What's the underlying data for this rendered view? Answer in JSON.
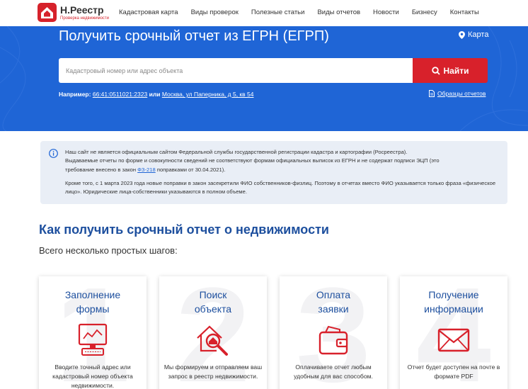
{
  "header": {
    "logo_name": "Н.Реестр",
    "logo_sub": "Проверка недвижимости",
    "nav": [
      "Кадастровая карта",
      "Виды проверок",
      "Полезные статьи",
      "Виды отчетов",
      "Новости",
      "Бизнесу",
      "Контакты"
    ]
  },
  "hero": {
    "title": "Получить срочный отчет из ЕГРН (ЕГРП)",
    "map_link": "Карта",
    "search_placeholder": "Кадастровый номер или адрес объекта",
    "search_button": "Найти",
    "example_label": "Например:",
    "example_cadastral": "66:41:0511021:2323",
    "example_or": "или",
    "example_address": "Москва, ул Паперника, д 5, кв 54",
    "samples_link": "Образцы отчетов"
  },
  "notice": {
    "p1_line1": "Наш сайт не является официальным сайтом Федеральной службы государственной регистрации кадастра и картографии (Росреестра).",
    "p1_line2": "Выдаваемые отчеты по форме и совокупности сведений не соответствуют формам официальных выписок из ЕГРН и не содержат подписи ЭЦП (это",
    "p1_line3_pre": "требование внесено в закон",
    "p1_law": "ФЗ-218",
    "p1_line3_post": "поправками от 30.04.2021).",
    "p2": "Кроме того, с 1 марта 2023 года новые поправки в закон засекретили ФИО собственников-физлиц. Поэтому в отчетах вместо ФИО указывается только фраза «физическое лицо». Юридические лица-собственники указываются в полном объеме."
  },
  "section": {
    "title": "Как получить срочный отчет о недвижимости",
    "subtitle": "Всего несколько простых шагов:"
  },
  "steps": [
    {
      "num": "1",
      "title1": "Заполнение",
      "title2": "формы",
      "text": "Вводите точный адрес или кадастровый номер объекта недвижимости.",
      "icon": "computer-icon"
    },
    {
      "num": "2",
      "title1": "Поиск",
      "title2": "объекта",
      "text": "Мы формируем и отправляем ваш запрос в реестр недвижимости.",
      "icon": "house-search-icon"
    },
    {
      "num": "3",
      "title1": "Оплата",
      "title2": "заявки",
      "text": "Оплачиваете отчет любым удобным для вас способом.",
      "icon": "wallet-icon"
    },
    {
      "num": "4",
      "title1": "Получение",
      "title2": "информации",
      "text": "Отчет будет доступен на почте в формате PDF",
      "icon": "envelope-icon"
    }
  ],
  "colors": {
    "primary_blue": "#1f65d6",
    "accent_red": "#d8212b",
    "title_blue": "#1d4f9e"
  }
}
